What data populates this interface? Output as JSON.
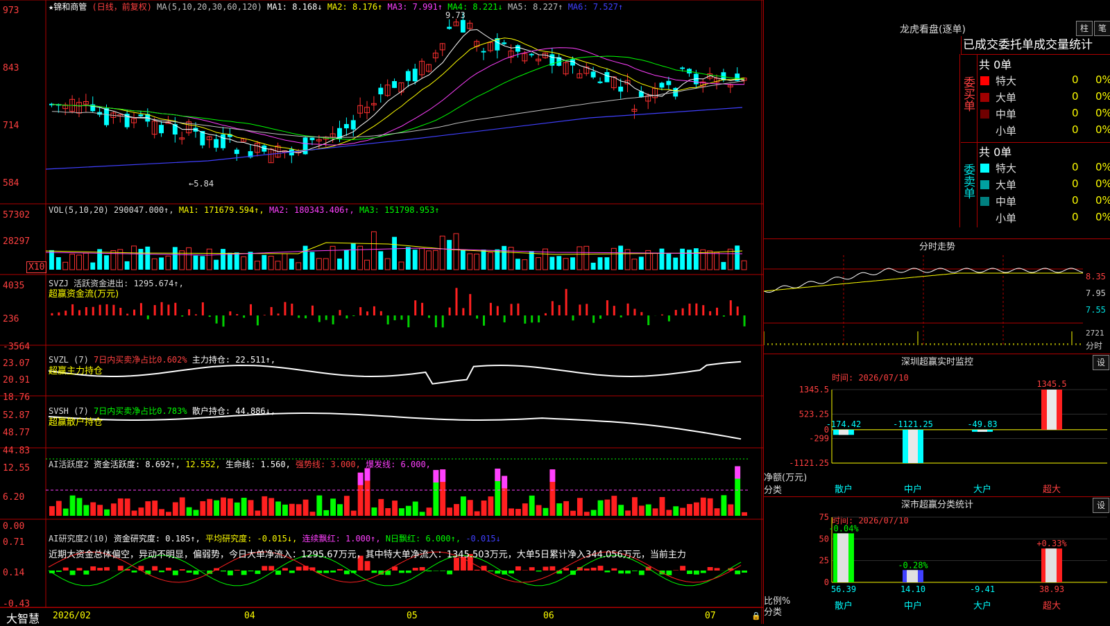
{
  "app": {
    "name": "大智慧"
  },
  "price_panel": {
    "stock_title": "★锦和商管",
    "mode": "(日线，前复权)",
    "ma_label": "MA(5,10,20,30,60,120)",
    "ma_values": [
      {
        "text": "MA1: 8.168↓",
        "color": "#ffffff"
      },
      {
        "text": "MA2: 8.176↑",
        "color": "#ffff00"
      },
      {
        "text": "MA3: 7.991↑",
        "color": "#ff40ff"
      },
      {
        "text": "MA4: 8.221↓",
        "color": "#00ff00"
      },
      {
        "text": "MA5: 8.227↑",
        "color": "#c0c0c0"
      },
      {
        "text": "MA6: 7.527↑",
        "color": "#4040ff"
      }
    ],
    "y_ticks": [
      "973",
      "843",
      "714",
      "584"
    ],
    "high_note": "9.73",
    "low_note": "←5.84"
  },
  "vol_panel": {
    "label": "VOL(5,10,20)",
    "value": "290047.000↑,",
    "ma1": "MA1: 171679.594↑,",
    "ma2": "MA2: 180343.406↑,",
    "ma3": "MA3: 151798.953↑",
    "y_ticks": [
      "57302",
      "28297"
    ],
    "unit": "X10"
  },
  "svzj_panel": {
    "label": "SVZJ  活跃资金进出: 1295.674↑,",
    "sub": "超赢资金流(万元)",
    "y_ticks": [
      "4035",
      "236",
      "-3564"
    ]
  },
  "svzl_panel": {
    "label": "SVZL (7)",
    "pct": "7日内买卖净占比0.602%",
    "hold": "主力持仓: 22.511↑,",
    "sub": "超赢主力持仓",
    "y_ticks": [
      "23.07",
      "20.91",
      "18.76"
    ]
  },
  "svsh_panel": {
    "label": "SVSH (7)",
    "pct": "7日内买卖净占比0.783%",
    "hold": "散户持仓: 44.886↓,",
    "sub": "超赢散户持仓",
    "y_ticks": [
      "52.87",
      "48.77",
      "44.83"
    ]
  },
  "ai_active_panel": {
    "label": "AI活跃度2",
    "v1": "资金活跃度: 8.692↑,",
    "v2": "12.552,",
    "v3": "生命线: 1.560,",
    "v4": "强势线: 3.000,",
    "v5": "爆发线: 6.000,",
    "y_ticks": [
      "12.55",
      "6.20",
      "0.00"
    ]
  },
  "ai_research_panel": {
    "label": "AI研究度2(10)",
    "v1": "资金研究度: 0.185↑,",
    "v2": "平均研究度: -0.015↓,",
    "v3": "连续飘红: 1.000↑,",
    "v4": "N日飘红: 6.000↑,",
    "v5": "-0.015↓",
    "comment": "近期大资金总体偏空，异动不明显，偏弱势，今日大单净流入：1295.67万元，其中特大单净流入：1345.503万元，大单5日累计净入344.056万元，当前主力",
    "y_ticks": [
      "0.71",
      "0.14",
      "-0.43"
    ]
  },
  "date_axis": [
    "2026/02",
    "04",
    "05",
    "06",
    "07"
  ],
  "longhu": {
    "title": "龙虎看盘(逐单)",
    "btn1": "柱",
    "btn2": "笔",
    "tabs": "已成交委托单成交量统计",
    "buy_label": "委买单",
    "sell_label": "委卖单",
    "buy_total": "共 0单",
    "sell_total": "共 0单",
    "buy_rows": [
      {
        "name": "特大",
        "count": "0",
        "pct": "0%",
        "color": "#ff0000"
      },
      {
        "name": "大单",
        "count": "0",
        "pct": "0%",
        "color": "#a00000"
      },
      {
        "name": "中单",
        "count": "0",
        "pct": "0%",
        "color": "#700000"
      },
      {
        "name": "小单",
        "count": "0",
        "pct": "0%",
        "color": "#000000"
      }
    ],
    "sell_rows": [
      {
        "name": "特大",
        "count": "0",
        "pct": "0%",
        "color": "#00ffff"
      },
      {
        "name": "大单",
        "count": "0",
        "pct": "0%",
        "color": "#00a0a0"
      },
      {
        "name": "中单",
        "count": "0",
        "pct": "0%",
        "color": "#008080"
      },
      {
        "name": "小单",
        "count": "0",
        "pct": "0%",
        "color": "#000000"
      }
    ]
  },
  "intraday": {
    "title": "分时走势",
    "y_ticks": [
      "8.35",
      "7.95",
      "7.55"
    ],
    "vol_label": "2721",
    "vol_unit": "分时"
  },
  "sz_monitor": {
    "title": "深圳超赢实时监控",
    "btn": "设",
    "time": "时间: 2026/07/10",
    "y_ticks": [
      "1345.5",
      "523.25",
      "0",
      "-299",
      "-1121.25"
    ],
    "y_title": "净额(万元)",
    "x_title": "分类"
  },
  "sz_class": {
    "title": "深市超赢分类统计",
    "btn": "设",
    "time": "时间: 2026/07/10",
    "y_ticks": [
      "75",
      "50",
      "25",
      "0"
    ],
    "y_title": "比例%",
    "x_title": "分类"
  },
  "chart_data": [
    {
      "type": "bar",
      "title": "深圳超赢实时监控",
      "ylabel": "净额(万元)",
      "xlabel": "分类",
      "categories": [
        "散户",
        "中户",
        "大户",
        "超大"
      ],
      "values": [
        -174.42,
        -1121.25,
        -49.83,
        1345.5
      ],
      "labels": [
        "-174.42",
        "-1121.25",
        "-49.83",
        "1345.5"
      ],
      "ylim": [
        -1121.25,
        1345.5
      ]
    },
    {
      "type": "bar",
      "title": "深市超赢分类统计",
      "ylabel": "比例%",
      "xlabel": "分类",
      "categories": [
        "散户",
        "中户",
        "大户",
        "超大"
      ],
      "values": [
        56.39,
        14.1,
        -9.41,
        38.93
      ],
      "changes": [
        "-0.04%",
        "-0.28%",
        "",
        "+0.33%"
      ],
      "labels": [
        "56.39",
        "14.10",
        "-9.41",
        "38.93"
      ],
      "ylim": [
        0,
        75
      ]
    }
  ]
}
